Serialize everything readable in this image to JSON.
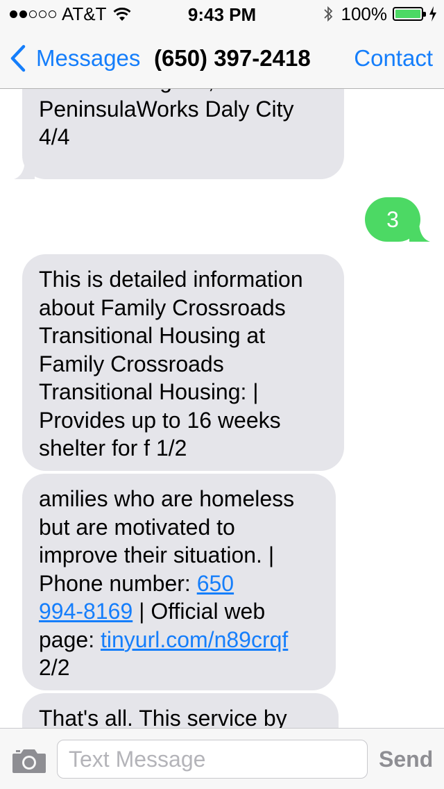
{
  "status_bar": {
    "carrier": "AT&T",
    "signal_dots_filled": 2,
    "signal_dots_total": 5,
    "time": "9:43 PM",
    "battery_percent": "100%",
    "battery_level": 1.0,
    "battery_color": "#4cd964"
  },
  "nav": {
    "back_label": "Messages",
    "title": "(650) 397-2418",
    "contact_label": "Contact",
    "accent_color": "#157efb"
  },
  "messages": [
    {
      "direction": "incoming",
      "lines": [
        "Northern Region.,",
        "PeninsulaWorks Daly City",
        "4/4"
      ]
    },
    {
      "direction": "outgoing",
      "text": "3"
    },
    {
      "direction": "incoming",
      "lines": [
        "This is detailed information",
        "about Family Crossroads",
        "Transitional Housing at",
        "Family Crossroads",
        "Transitional Housing: |",
        "Provides up to 16 weeks",
        "shelter for f 1/2"
      ]
    },
    {
      "direction": "incoming",
      "line1": "amilies who are homeless",
      "line2": "but are motivated to",
      "line3": "improve their situation. |",
      "phone_prefix": "Phone number: ",
      "phone_part1": "650",
      "phone_part2": "994-8169",
      "after_phone": " | Official web",
      "web_prefix": "page: ",
      "web_link": "tinyurl.com/n89crqf",
      "last_line": "2/2"
    },
    {
      "direction": "incoming",
      "lines": [
        "That's all. This service by"
      ]
    }
  ],
  "input": {
    "placeholder": "Text Message",
    "value": "",
    "send_label": "Send"
  }
}
